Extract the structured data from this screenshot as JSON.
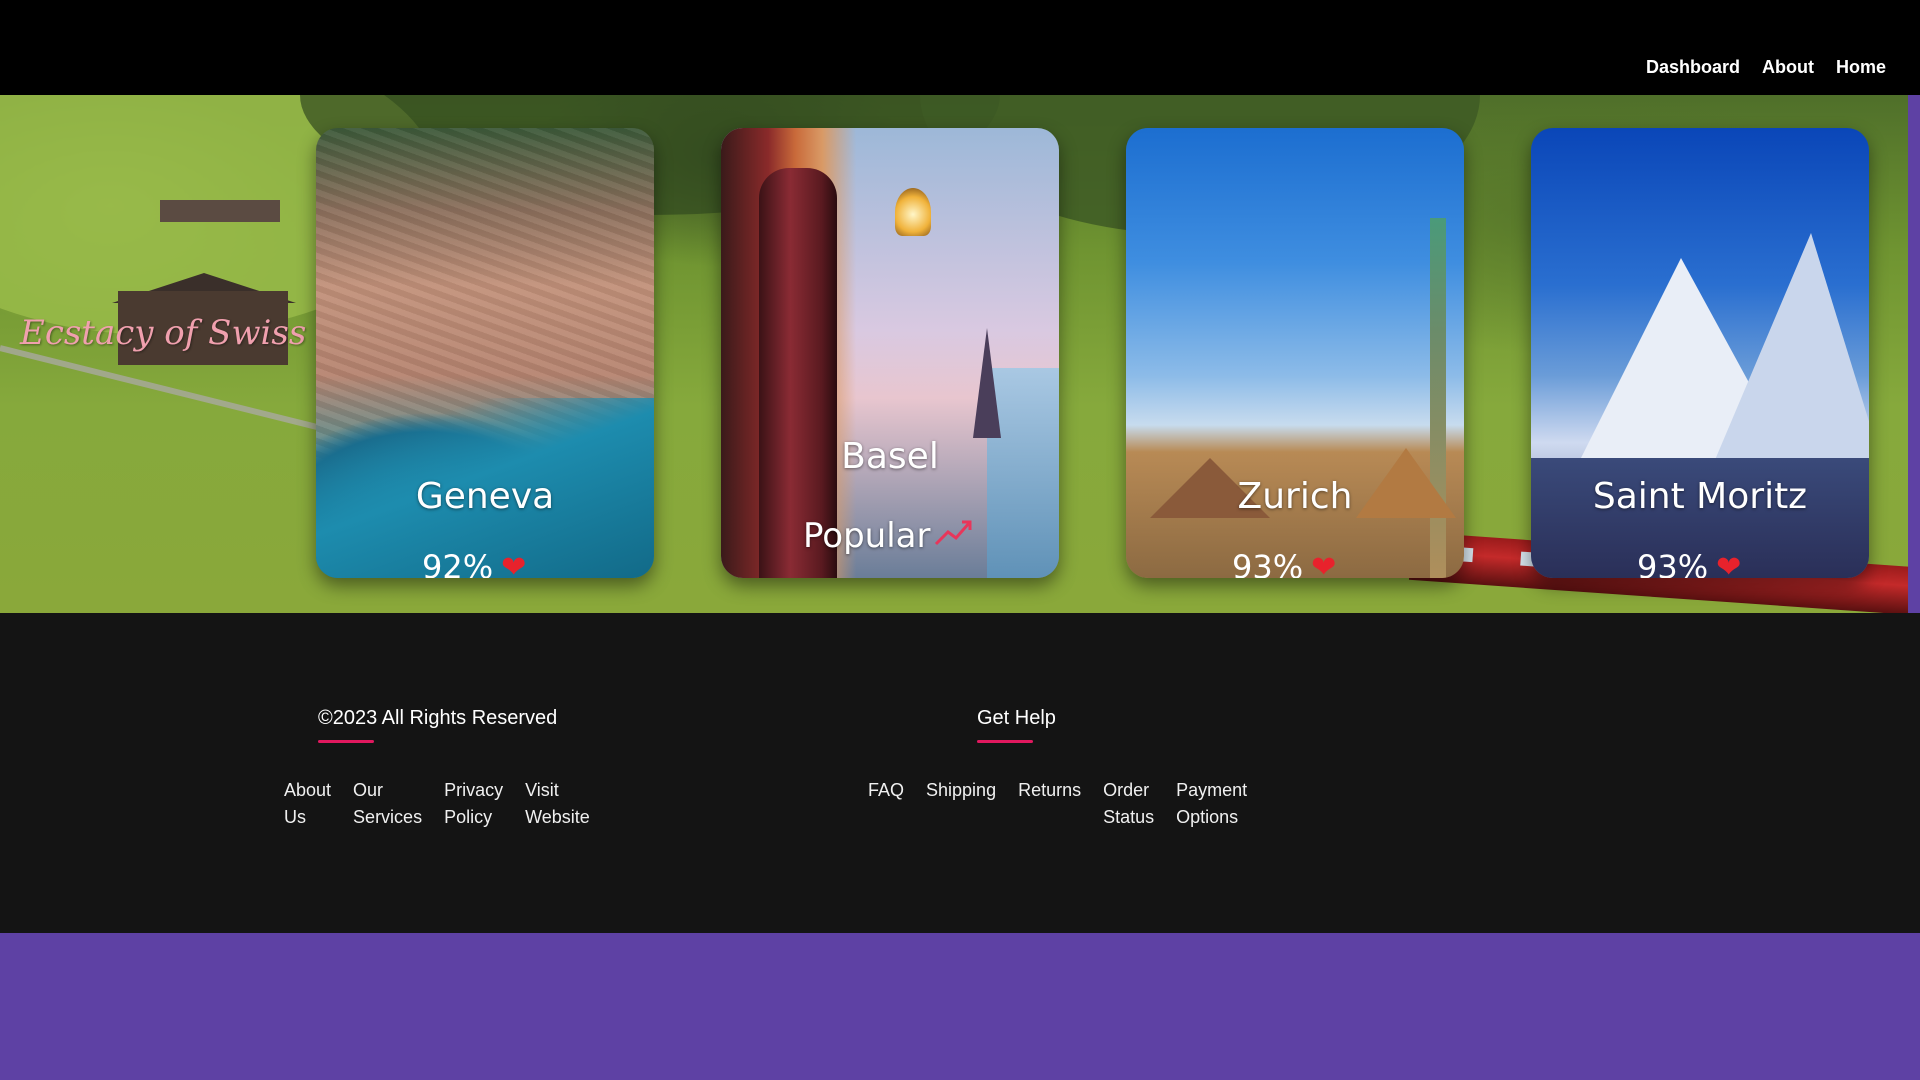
{
  "nav": {
    "dashboard": "Dashboard",
    "about": "About",
    "home": "Home"
  },
  "hero": {
    "site_title": "Ecstacy of Swiss"
  },
  "cards": [
    {
      "name": "Geneva",
      "stat": "92%",
      "icon": "heart-icon"
    },
    {
      "name": "Basel",
      "tag": "Popular",
      "icon": "trending-up-icon"
    },
    {
      "name": "Zurich",
      "stat": "93%",
      "icon": "heart-icon"
    },
    {
      "name": "Saint Moritz",
      "stat": "93%",
      "icon": "heart-icon"
    }
  ],
  "footer": {
    "copyright": "©2023 All Rights Reserved",
    "help_heading": "Get Help",
    "left_links": [
      {
        "line1": "About",
        "line2": "Us"
      },
      {
        "line1": "Our",
        "line2": "Services"
      },
      {
        "line1": "Privacy",
        "line2": "Policy"
      },
      {
        "line1": "Visit",
        "line2": "Website"
      }
    ],
    "help_links": [
      {
        "line1": "FAQ",
        "line2": ""
      },
      {
        "line1": "Shipping",
        "line2": ""
      },
      {
        "line1": "Returns",
        "line2": ""
      },
      {
        "line1": "Order",
        "line2": "Status"
      },
      {
        "line1": "Payment",
        "line2": "Options"
      }
    ]
  },
  "colors": {
    "accent": "#e0185e",
    "page_background": "#5e41a4",
    "footer_background": "#141414"
  }
}
